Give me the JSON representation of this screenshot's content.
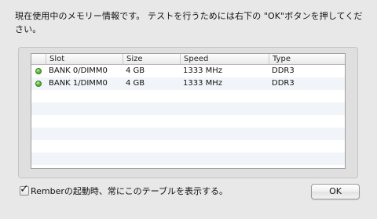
{
  "message": {
    "text": "現在使用中のメモリー情報です。 テストを行うためには右下の \"OK\"ボタンを押してください。"
  },
  "table": {
    "columns": [
      "",
      "Slot",
      "Size",
      "Speed",
      "Type"
    ],
    "rows": [
      {
        "status_icon": "green-status-dot-icon",
        "slot": "BANK 0/DIMM0",
        "size": "4 GB",
        "speed": "1333 MHz",
        "type": "DDR3"
      },
      {
        "status_icon": "green-status-dot-icon",
        "slot": "BANK 1/DIMM0",
        "size": "4 GB",
        "speed": "1333 MHz",
        "type": "DDR3"
      }
    ],
    "empty_row_count": 6
  },
  "footer": {
    "checkbox_checked": true,
    "checkbox_label": "Remberの起動時、常にこのテーブルを表示する。",
    "ok_label": "OK"
  },
  "colors": {
    "window_bg": "#e8e8e8",
    "status_green": "#5fc43b",
    "alt_row": "#f1f5fa"
  }
}
